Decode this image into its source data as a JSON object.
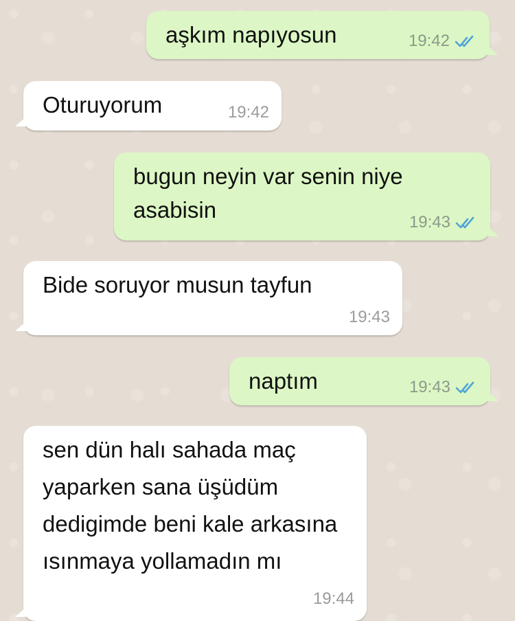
{
  "colors": {
    "background": "#e5ddd4",
    "outgoing_bubble": "#dcf7c5",
    "incoming_bubble": "#ffffff",
    "read_ticks": "#4fa3d8"
  },
  "messages": [
    {
      "direction": "outgoing",
      "text": "aşkım napıyosun",
      "time": "19:42",
      "status_icon": "double-check-icon"
    },
    {
      "direction": "incoming",
      "text": "Oturuyorum",
      "time": "19:42"
    },
    {
      "direction": "outgoing",
      "text": "bugun neyin var senin niye asabisin",
      "time": "19:43",
      "status_icon": "double-check-icon"
    },
    {
      "direction": "incoming",
      "text": "Bide soruyor musun tayfun",
      "time": "19:43"
    },
    {
      "direction": "outgoing",
      "text": "naptım",
      "time": "19:43",
      "status_icon": "double-check-icon"
    },
    {
      "direction": "incoming",
      "text": "sen dün halı sahada maç yaparken sana üşüdüm dedigimde beni kale arkasına ısınmaya yollamadın mı",
      "time": "19:44"
    }
  ]
}
